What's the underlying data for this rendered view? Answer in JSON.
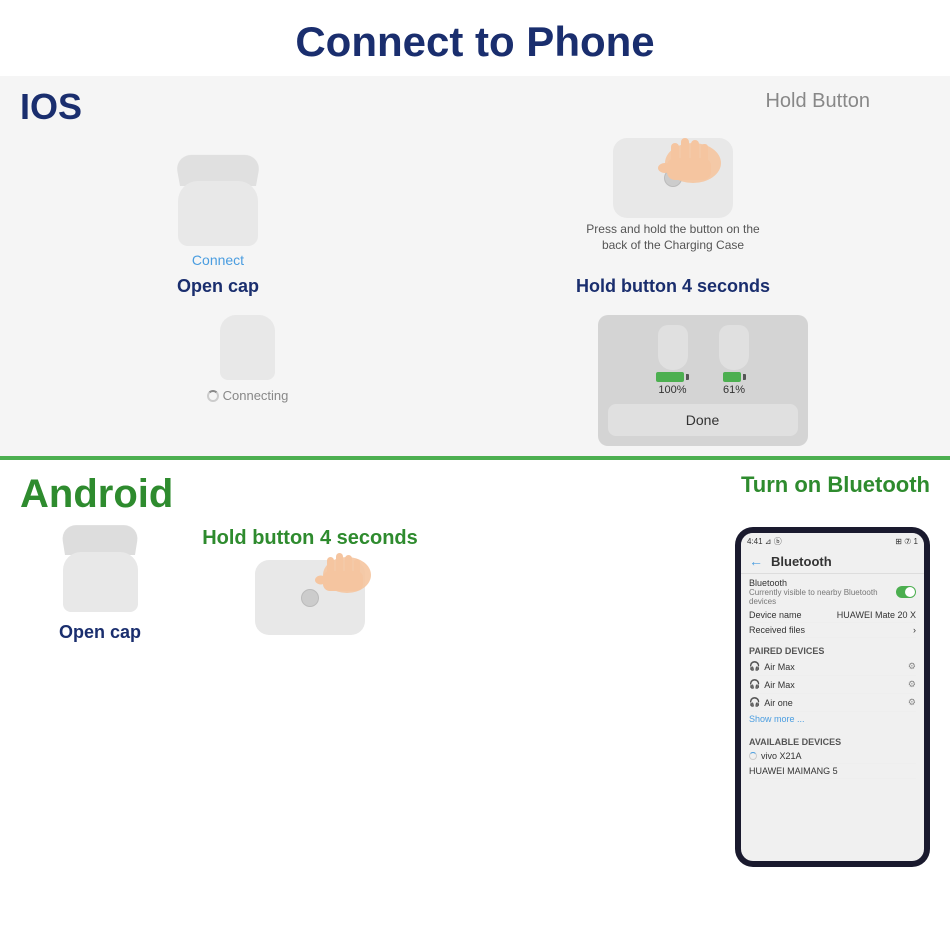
{
  "page": {
    "title": "Connect to Phone",
    "background": "#ffffff"
  },
  "ios": {
    "section_label": "IOS",
    "hold_button": "Hold Button",
    "col1": {
      "connect_label": "Connect",
      "step_label": "Open cap"
    },
    "col2": {
      "press_description": "Press and hold the button on the\nback of the Charging Case",
      "step_label": "Hold button 4 seconds"
    },
    "row2_left": {
      "connecting_label": "Connecting"
    },
    "row2_right": {
      "battery1_pct": "100%",
      "battery2_pct": "61%",
      "done_button": "Done"
    }
  },
  "android": {
    "section_label": "Android",
    "turn_on_bt": "Turn on Bluetooth",
    "left": {
      "open_cap": "Open cap"
    },
    "middle": {
      "hold_label": "Hold button 4 seconds"
    },
    "phone": {
      "status_left": "4:41 ⊿ ⓑ",
      "status_right": "⊞ ⑦ 1",
      "title": "Bluetooth",
      "bt_label": "Bluetooth",
      "bt_sub": "Currently visible to nearby Bluetooth devices",
      "device_name_label": "Device name",
      "device_name_value": "HUAWEI Mate 20 X",
      "received_files": "Received files",
      "paired_title": "PAIRED DEVICES",
      "device1": "Air Max",
      "device2": "Air Max",
      "device3": "Air one",
      "show_more": "Show more ...",
      "available_title": "AVAILABLE DEVICES",
      "avail1": "vivo X21A",
      "avail2": "HUAWEI MAIMANG 5"
    }
  }
}
